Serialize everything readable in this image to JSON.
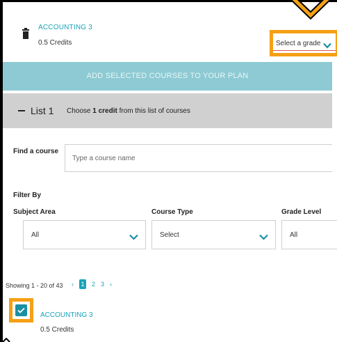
{
  "top_course": {
    "title": "ACCOUNTING 3",
    "credits": "0.5 Credits",
    "grade_select": "Select a grade"
  },
  "add_bar": {
    "label": "ADD SELECTED COURSES TO YOUR PLAN"
  },
  "list": {
    "title": "List 1",
    "desc_prefix": "Choose ",
    "desc_bold": "1 credit",
    "desc_suffix": " from this list of courses"
  },
  "find": {
    "label": "Find a course",
    "placeholder": "Type a course name"
  },
  "filters": {
    "heading": "Filter By",
    "subject": {
      "label": "Subject Area",
      "value": "All"
    },
    "type": {
      "label": "Course Type",
      "value": "Select"
    },
    "grade": {
      "label": "Grade Level",
      "value": "All"
    }
  },
  "pagination": {
    "showing": "Showing 1 - 20 of 43",
    "prev": "‹",
    "pages": [
      "1",
      "2",
      "3"
    ],
    "next": "›"
  },
  "item": {
    "title": "ACCOUNTING 3",
    "credits": "0.5 Credits",
    "checked": true
  },
  "colors": {
    "accent": "#1aa3b8",
    "highlight": "#f5a015",
    "add_bar": "#8dcad3",
    "list_header": "#d0d0d0"
  }
}
